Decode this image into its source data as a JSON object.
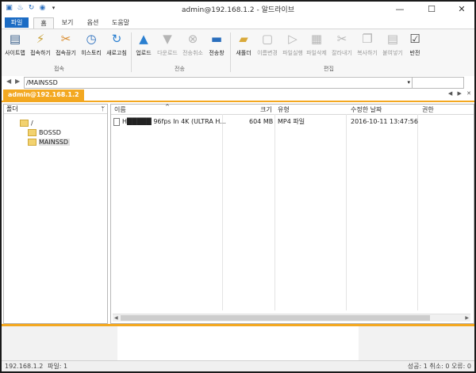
{
  "window": {
    "title": "admin@192.168.1.2 - 알드라이브",
    "minimize_glyph": "—",
    "maximize_glyph": "☐",
    "close_glyph": "✕"
  },
  "quick_access": [
    "sitemap-icon",
    "connect-icon",
    "refresh-icon",
    "globe-icon",
    "dropdown-icon"
  ],
  "tabs": [
    {
      "label": "파일"
    },
    {
      "label": "홈"
    },
    {
      "label": "보기"
    },
    {
      "label": "옵션"
    },
    {
      "label": "도움말"
    }
  ],
  "ribbon": {
    "groups": {
      "connect": "접속",
      "transfer": "전송",
      "edit": "편집"
    },
    "buttons": [
      {
        "label": "사이트맵",
        "icon": "sitemap-icon"
      },
      {
        "label": "접속하기",
        "icon": "plug-icon"
      },
      {
        "label": "접속끊기",
        "icon": "unplug-icon"
      },
      {
        "label": "히스토리",
        "icon": "history-clock-icon"
      },
      {
        "label": "새로고침",
        "icon": "refresh-icon"
      },
      {
        "label": "업로드",
        "icon": "upload-arrow-icon"
      },
      {
        "label": "다운로드",
        "icon": "download-arrow-icon"
      },
      {
        "label": "전송취소",
        "icon": "cancel-x-icon"
      },
      {
        "label": "전송창",
        "icon": "transfer-window-icon"
      },
      {
        "label": "새폴더",
        "icon": "new-folder-icon"
      },
      {
        "label": "이름변경",
        "icon": "rename-icon"
      },
      {
        "label": "파일실행",
        "icon": "run-file-icon"
      },
      {
        "label": "파일삭제",
        "icon": "delete-file-icon"
      },
      {
        "label": "잘라내기",
        "icon": "scissors-icon"
      },
      {
        "label": "복사하기",
        "icon": "copy-icon"
      },
      {
        "label": "붙여넣기",
        "icon": "paste-icon"
      },
      {
        "label": "반전",
        "icon": "invert-select-icon"
      }
    ]
  },
  "address": {
    "back": "◀",
    "forward": "▶",
    "path": "/MAINSSD",
    "dropdown": "▾"
  },
  "session_tab": {
    "label": "admin@192.168.1.2",
    "nav": "◀ ▶ ✕"
  },
  "folder_panel": {
    "header": "폴더",
    "pin": "ᛘ",
    "nodes": [
      {
        "label": "/"
      },
      {
        "label": "BOSSD"
      },
      {
        "label": "MAINSSD"
      }
    ]
  },
  "file_list": {
    "sort_indicator": "^",
    "columns": [
      "이름",
      "크기",
      "유형",
      "수정한 날짜",
      "권한"
    ],
    "rows": [
      {
        "name": "H█████ 96fps In 4K (ULTRA H...",
        "size": "604 MB",
        "type": "MP4 파일",
        "modified": "2016-10-11 13:47:56",
        "permission": ""
      }
    ]
  },
  "status": {
    "left": "192.168.1.2",
    "files": "파일: 1",
    "right": "성공: 1 취소: 0 오류: 0"
  }
}
